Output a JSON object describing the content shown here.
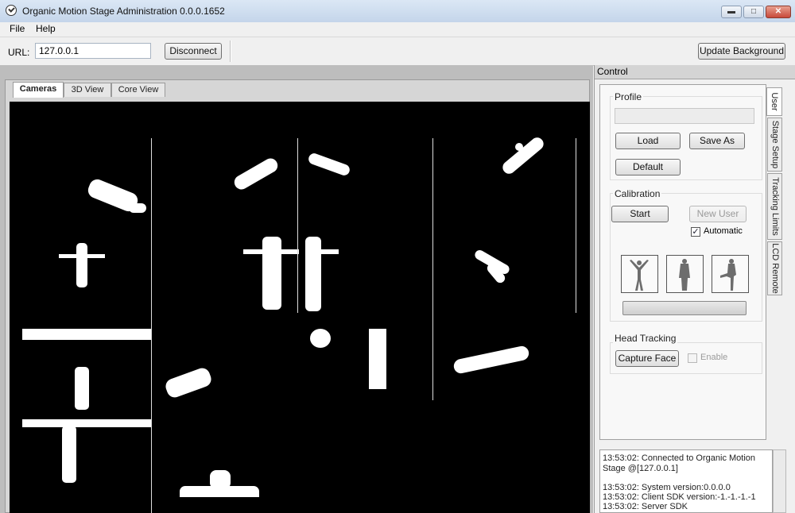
{
  "window": {
    "title": "Organic Motion Stage Administration 0.0.0.1652",
    "minimize_icon": "minimize-icon",
    "maximize_icon": "maximize-icon",
    "close_icon": "close-icon"
  },
  "menu": {
    "file": "File",
    "help": "Help"
  },
  "toolbar": {
    "url_label": "URL:",
    "url_value": "127.0.0.1",
    "disconnect_label": "Disconnect",
    "update_background_label": "Update Background"
  },
  "view_tabs": [
    {
      "label": "Cameras",
      "active": true
    },
    {
      "label": "3D View",
      "active": false
    },
    {
      "label": "Core View",
      "active": false
    }
  ],
  "control": {
    "title": "Control",
    "side_tabs": [
      {
        "label": "User",
        "active": true
      },
      {
        "label": "Stage Setup",
        "active": false
      },
      {
        "label": "Tracking Limits",
        "active": false
      },
      {
        "label": "LCD Remote",
        "active": false
      }
    ],
    "profile": {
      "group_label": "Profile",
      "name_value": "",
      "load_label": "Load",
      "save_as_label": "Save As",
      "default_label": "Default"
    },
    "calibration": {
      "group_label": "Calibration",
      "start_label": "Start",
      "new_user_label": "New User",
      "automatic_label": "Automatic",
      "automatic_checked": true,
      "progress": 0
    },
    "head_tracking": {
      "group_label": "Head Tracking",
      "capture_face_label": "Capture Face",
      "enable_label": "Enable",
      "enable_checked": false
    }
  },
  "log": [
    "13:53:02: Connected to Organic Motion",
    "Stage @[127.0.0.1]",
    "",
    "13:53:02: System version:0.0.0.0",
    "13:53:02: Client SDK version:-1.-1.-1.-1",
    "13:53:02: Server SDK"
  ]
}
